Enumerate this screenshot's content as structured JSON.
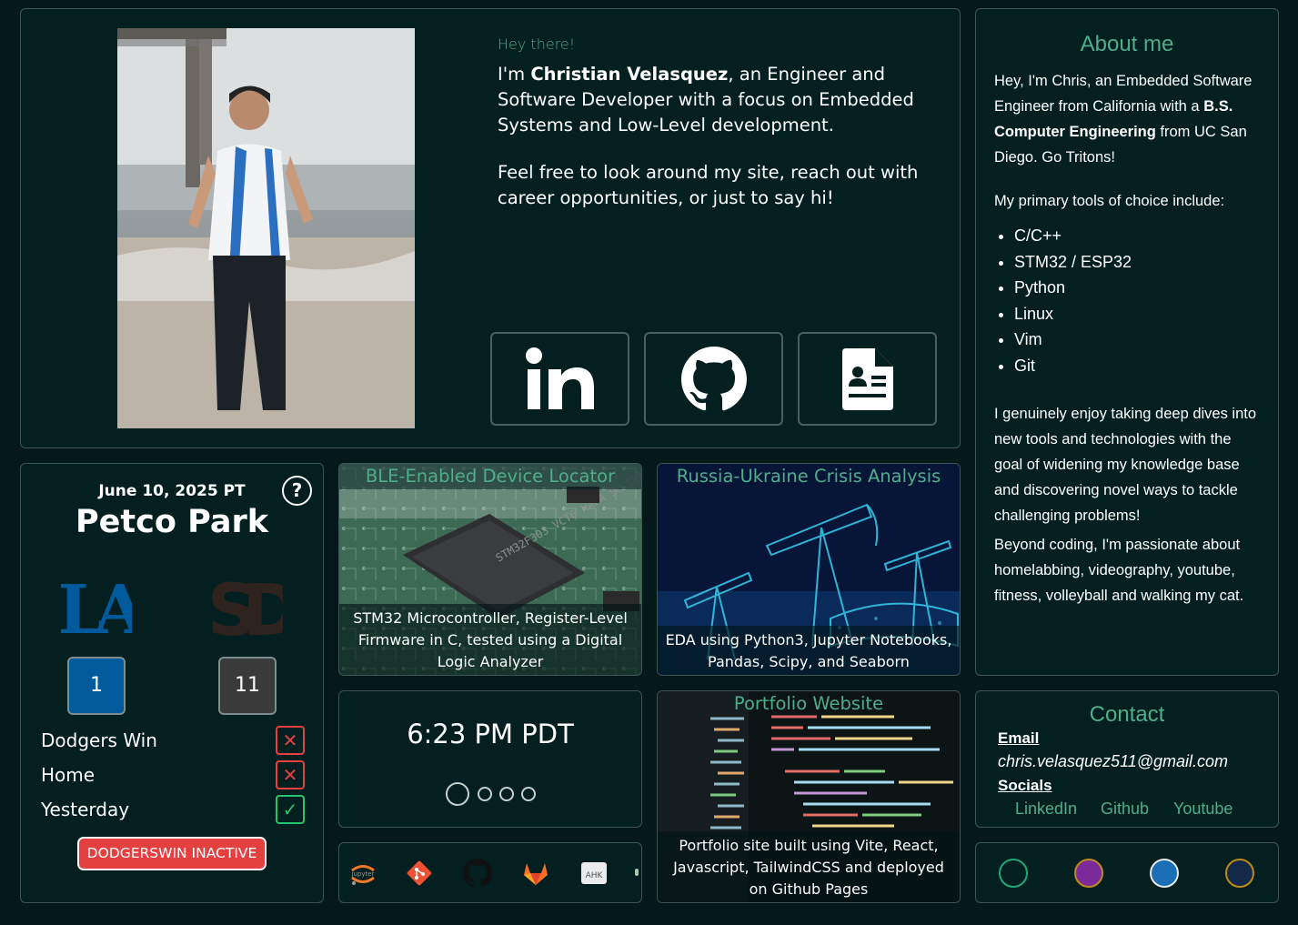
{
  "colors": {
    "accent": "#4fae8a",
    "background": "#06191a",
    "card": "#031f1f",
    "border": "#3c5656",
    "dodgers_blue": "#005a9c",
    "padres_brown": "#2f241d",
    "red": "#e44040",
    "green": "#26c56b"
  },
  "hero": {
    "greeting": "Hey there!",
    "intro_prefix": "I'm ",
    "name": "Christian Velasquez",
    "intro_suffix": ", an Engineer and Software Developer with a focus on Embedded Systems and Low-Level development.",
    "invite": "Feel free to look around my site, reach out with career opportunities, or just to say hi!",
    "buttons": [
      {
        "label": "LinkedIn",
        "icon": "linkedin-icon"
      },
      {
        "label": "Github",
        "icon": "github-icon"
      },
      {
        "label": "Resume",
        "icon": "resume-icon"
      }
    ]
  },
  "about": {
    "title": "About me",
    "p1_a": "Hey, I'm Chris, an Embedded Software Engineer from California with a ",
    "p1_bold": "B.S. Computer Engineering",
    "p1_b": " from UC San Diego. Go Tritons!",
    "tools_intro": "My primary tools of choice include:",
    "tools": [
      "C/C++",
      "STM32 / ESP32",
      "Python",
      "Linux",
      "Vim",
      "Git"
    ],
    "p3": "I genuinely enjoy taking deep dives into new tools and technologies with the goal of widening my knowledge base and discovering novel ways to tackle challenging problems!",
    "p4": "Beyond coding, I'm passionate about homelabbing, videography, youtube, fitness, volleyball and walking my cat."
  },
  "game": {
    "date": "June 10, 2025 PT",
    "venue": "Petco Park",
    "help": "?",
    "away_logo": "LA",
    "home_logo": "SD",
    "away_score": "1",
    "home_score": "11",
    "rows": [
      {
        "label": "Dodgers Win",
        "status": "false",
        "symbol": "✕"
      },
      {
        "label": "Home",
        "status": "false",
        "symbol": "✕"
      },
      {
        "label": "Yesterday",
        "status": "true",
        "symbol": "✓"
      }
    ],
    "button": "DODGERSWIN INACTIVE"
  },
  "projects": [
    {
      "title": "BLE-Enabled Device Locator",
      "desc": "STM32 Microcontroller, Register-Level Firmware in C, tested using a Digital Logic Analyzer",
      "chip_text": "STM32F303 VCT6 HAFA 9U CHN HP 301"
    },
    {
      "title": "Russia-Ukraine Crisis Analysis",
      "desc": "EDA using Python3, Jupyter Notebooks, Pandas, Scipy, and Seaborn"
    },
    {
      "title": "Portfolio Website",
      "desc": "Portfolio site built using Vite, React, Javascript, TailwindCSS and deployed on Github Pages"
    }
  ],
  "clock": {
    "time": "6:23 PM PDT",
    "active_index": 0
  },
  "tools_bar": [
    {
      "icon": "jupyter-icon",
      "text": "jupyter"
    },
    {
      "icon": "git-icon"
    },
    {
      "icon": "github-icon"
    },
    {
      "icon": "gitlab-icon"
    },
    {
      "icon": "autohotkey-icon",
      "text": "AHK"
    }
  ],
  "contact": {
    "title": "Contact",
    "email_label": "Email",
    "email": "chris.velasquez511@gmail.com",
    "socials_label": "Socials",
    "links": [
      "LinkedIn",
      "Github",
      "Youtube"
    ]
  },
  "themes": [
    "#1fa777",
    "#7b2a9b",
    "#1a6fb6",
    "#c08a19"
  ]
}
